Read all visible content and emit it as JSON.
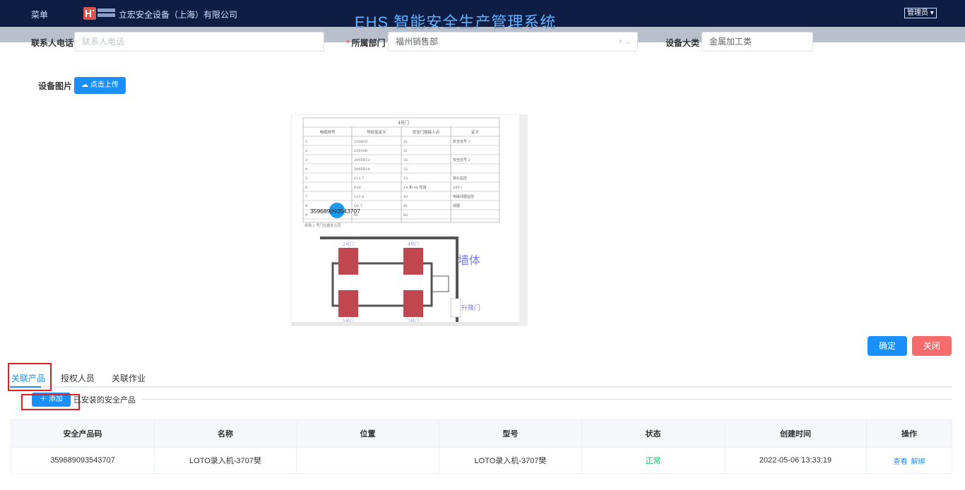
{
  "header": {
    "menu_label": "菜单",
    "company": "立宏安全设备（上海）有限公司",
    "system_title": "EHS 智能安全生产管理系统",
    "user_menu": "管理员"
  },
  "form": {
    "contact_phone": {
      "label": "联系人电话",
      "placeholder": "联系人电话"
    },
    "department": {
      "label": "所属部门",
      "value": "福州销售部"
    },
    "device_category": {
      "label": "设备大类",
      "value": "金属加工类"
    },
    "device_image": {
      "label": "设备图片",
      "upload_label": "点击上传"
    }
  },
  "preview": {
    "table_header": "4号门",
    "columns": [
      "电缆线号",
      "号码至定义",
      "安全门插接入点",
      "定义"
    ],
    "rows": [
      [
        "1",
        "230H01",
        "21",
        "安全信号 1"
      ],
      [
        "2",
        "230100",
        "31",
        ""
      ],
      [
        "3",
        "2005R13",
        "32",
        "安全信号 2"
      ],
      [
        "4",
        "2005R14",
        "22",
        ""
      ],
      [
        "5",
        "111.7",
        "13",
        "锁头监控"
      ],
      [
        "6",
        "P24",
        "14 和 44 短接",
        "24V+"
      ],
      [
        "7",
        "111.6",
        "43",
        "电磁线圈监控"
      ],
      [
        "8",
        "Q1.7",
        "81",
        "线圈"
      ],
      [
        "9",
        "M",
        "82",
        ""
      ]
    ],
    "note": "现场 2 号门位置定义同",
    "marker_code": "359689093543707",
    "door_labels": [
      "2号门",
      "4号门",
      "1号门",
      "3号门"
    ],
    "wall_label": "墙体",
    "lift_door_label": "升降门"
  },
  "actions": {
    "confirm_label": "确定",
    "close_label": "关闭"
  },
  "tabs": [
    {
      "label": "关联产品",
      "active": true
    },
    {
      "label": "授权人员",
      "active": false
    },
    {
      "label": "关联作业",
      "active": false
    }
  ],
  "products": {
    "add_label": "添加",
    "section_title": "已安装的安全产品",
    "columns": [
      "安全产品码",
      "名称",
      "位置",
      "型号",
      "状态",
      "创建时间",
      "操作"
    ],
    "rows": [
      {
        "code": "359689093543707",
        "name": "LOTO录入机-3707樊",
        "location": "",
        "model": "LOTO录入机-3707樊",
        "status": "正常",
        "created": "2022-05-06 13:33:19",
        "action_view": "查看",
        "action_unbind": "解绑"
      }
    ]
  },
  "colors": {
    "primary": "#1890ff",
    "danger": "#f56c6c",
    "success": "#19be6b",
    "header_bg": "#0e1d44"
  }
}
